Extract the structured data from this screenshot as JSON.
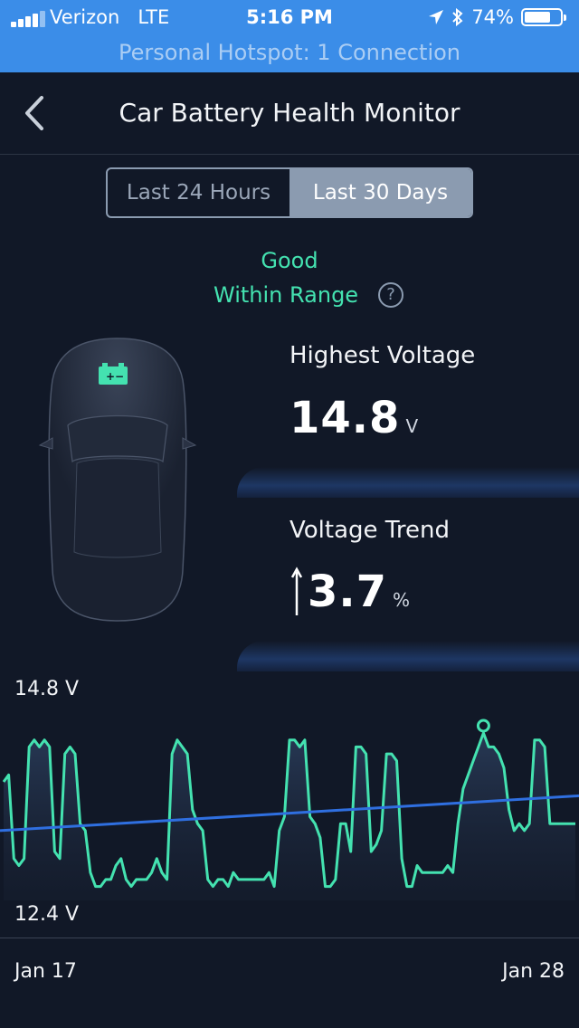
{
  "status_bar": {
    "carrier": "Verizon",
    "network": "LTE",
    "time": "5:16 PM",
    "battery_percent": "74%",
    "battery_level": 0.74,
    "hotspot": "Personal Hotspot: 1 Connection"
  },
  "nav": {
    "title": "Car Battery Health Monitor"
  },
  "segments": {
    "option1": "Last 24 Hours",
    "option2": "Last 30 Days",
    "selected": "Last 30 Days"
  },
  "status": {
    "line1": "Good",
    "line2": "Within Range",
    "help": "?"
  },
  "highest": {
    "label": "Highest Voltage",
    "value": "14.8",
    "unit": "V"
  },
  "trend": {
    "label": "Voltage Trend",
    "value": "3.7",
    "unit": "%"
  },
  "chart_data": {
    "type": "line",
    "y_top_label": "14.8 V",
    "y_bottom_label": "12.4 V",
    "ylim": [
      12.4,
      14.8
    ],
    "x_start_label": "Jan 17",
    "x_end_label": "Jan 28",
    "colors": {
      "series": "#44e2b0",
      "trend": "#2f6fe0"
    },
    "series": [
      {
        "values": [
          14.1,
          14.2,
          13.0,
          12.9,
          13.0,
          14.6,
          14.7,
          14.6,
          14.7,
          14.6,
          13.1,
          13.0,
          14.5,
          14.6,
          14.5,
          13.5,
          13.4,
          12.8,
          12.6,
          12.6,
          12.7,
          12.7,
          12.9,
          13.0,
          12.7,
          12.6,
          12.7,
          12.7,
          12.7,
          12.8,
          13.0,
          12.8,
          12.7,
          14.5,
          14.7,
          14.6,
          14.5,
          13.7,
          13.5,
          13.4,
          12.7,
          12.6,
          12.7,
          12.7,
          12.6,
          12.8,
          12.7,
          12.7,
          12.7,
          12.7,
          12.7,
          12.7,
          12.8,
          12.6,
          13.4,
          13.6,
          14.7,
          14.7,
          14.6,
          14.7,
          13.6,
          13.5,
          13.3,
          12.6,
          12.6,
          12.7,
          13.5,
          13.5,
          13.1,
          14.6,
          14.6,
          14.5,
          13.1,
          13.2,
          13.4,
          14.5,
          14.5,
          14.4,
          13.0,
          12.6,
          12.6,
          12.9,
          12.8,
          12.8,
          12.8,
          12.8,
          12.8,
          12.9,
          12.8,
          13.5,
          14.0,
          14.2,
          14.4,
          14.6,
          14.8,
          14.6,
          14.6,
          14.5,
          14.3,
          13.7,
          13.4,
          13.5,
          13.4,
          13.5,
          14.7,
          14.7,
          14.6,
          13.5,
          13.5,
          13.5,
          13.5,
          13.5,
          13.5
        ]
      },
      {
        "name": "",
        "values": [
          13.4,
          13.9
        ]
      }
    ]
  }
}
